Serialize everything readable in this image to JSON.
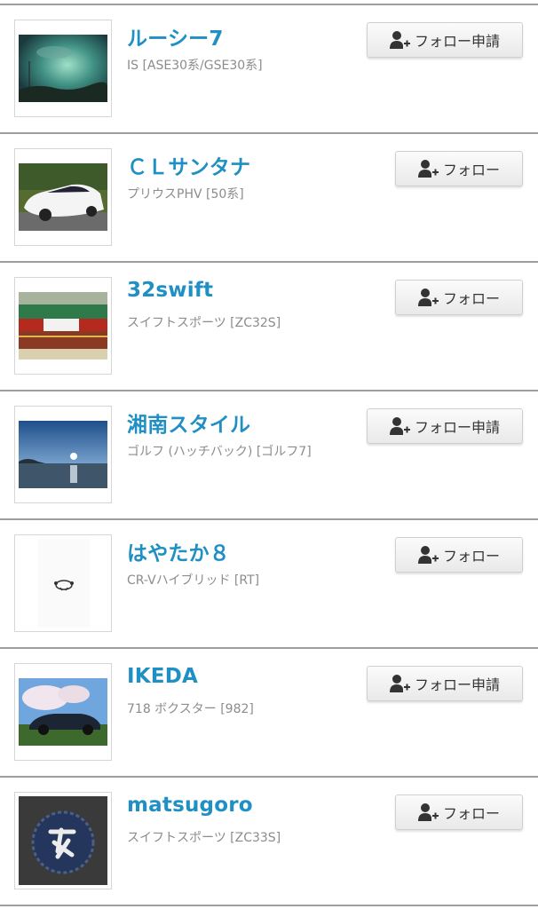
{
  "users": [
    {
      "name": "ルーシー7",
      "car": "IS [ASE30系/GSE30系]",
      "button": "フォロー申請",
      "button_icon": "add-user-icon"
    },
    {
      "name": "ＣＬサンタナ",
      "car": "プリウスPHV [50系]",
      "button": "フォロー",
      "button_icon": "add-user-icon"
    },
    {
      "name": "32swift",
      "car": "スイフトスポーツ [ZC32S]",
      "button": "フォロー",
      "button_icon": "add-user-icon"
    },
    {
      "name": "湘南スタイル",
      "car": "ゴルフ (ハッチバック) [ゴルフ7]",
      "button": "フォロー申請",
      "button_icon": "add-user-icon"
    },
    {
      "name": "はやたか８",
      "car": "CR-Vハイブリッド [RT]",
      "button": "フォロー",
      "button_icon": "add-user-icon"
    },
    {
      "name": "IKEDA",
      "car": "718 ボクスター [982]",
      "button": "フォロー申請",
      "button_icon": "add-user-icon"
    },
    {
      "name": "matsugoro",
      "car": "スイフトスポーツ [ZC33S]",
      "button": "フォロー",
      "button_icon": "add-user-icon"
    }
  ],
  "colors": {
    "name_link": "#1f8fc4",
    "subtext": "#8c8c8c",
    "divider": "#9e9e9e"
  }
}
